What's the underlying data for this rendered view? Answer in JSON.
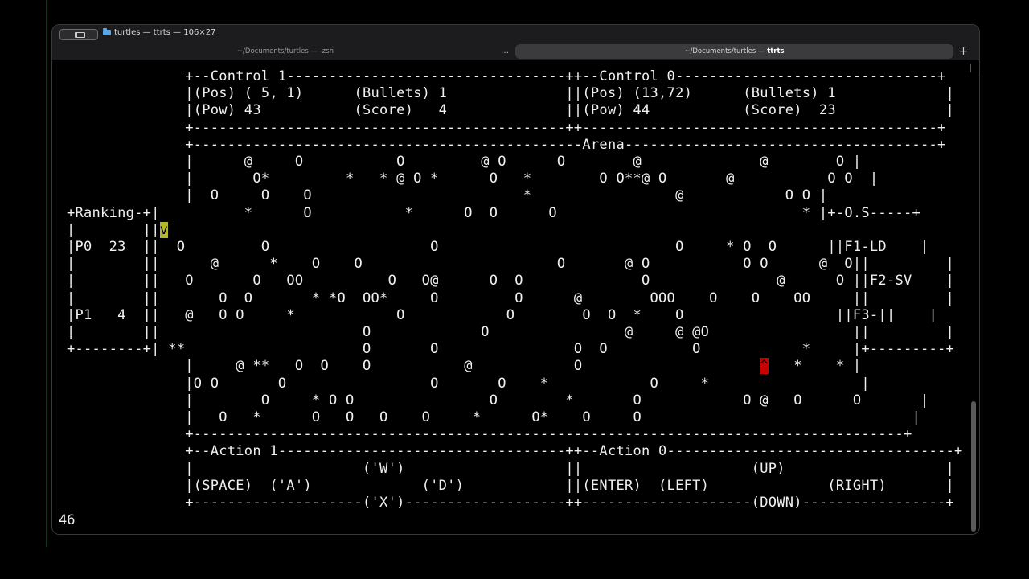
{
  "window": {
    "title": "turtles — ttrts — 106×27",
    "tabs": [
      {
        "label": "~/Documents/turtles — -zsh"
      },
      {
        "label_prefix": "~/Documents/turtles — ",
        "label_bold": "ttrts"
      }
    ],
    "overflow_tabs": "…",
    "new_tab": "+"
  },
  "terminal": {
    "status": "46",
    "colors": {
      "player_highlight": "#b5b82b",
      "enemy_highlight": "#c80000"
    },
    "player_glyph": "v",
    "enemy_glyph": "^",
    "lines": [
      "              +--Control 1---------------------------------++--Control 0-------------------------------+",
      "              |(Pos) ( 5, 1)      (Bullets) 1              ||(Pos) (13,72)      (Bullets) 1             |",
      "              |(Pow) 43           (Score)   4              ||(Pow) 44           (Score)  23             |",
      "              +--------------------------------------------++------------------------------------------+",
      "              +----------------------------------------------Arena-------------------------------------+",
      "              |      @     O           O         @ O      O        @              @        O |",
      "              |       O*         *   * @ O *      O   *        O O**@ O       @           O O  |",
      "              |  O     O    O                         *                 @            O O |",
      "+Ranking-+|          *      O           *      O  O      O                             * |+-O.S-----+",
      "|        ||",
      "|P0  23  ||  O         O                   O                            O     * O  O      ||F1-LD    |",
      "|        ||      @      *    O    O                       O       @ O           O O      @  O||         |",
      "|        ||   O       O   OO          O   O@      O  O              O               @      O ||F2-SV    |",
      "|        ||       O  O       * *O  OO*     O         O      @        OOO    O    O    OO     ||         |",
      "|P1   4  ||   @   O O     *            O            O        O  O  *    O                  ||F3-||    |",
      "|        ||                        O             O                @     @ @O                 ||         |",
      "+--------+| **                     O       O                O  O          O            *     |+---------+",
      "              |     @ **   O  O    O           @            O                         *    * |",
      "              |O O       O                 O       O    *            O     *                  |",
      "              |        O     * O O                O        *       O            O @   O      O       |",
      "              |   O   *      O   O   O    O     *      O*    O     O                                |",
      "              +------------------------------------------------------------------------------------+",
      "              +--Action 1----------------------------------++--Action 0----------------------------------+",
      "              |                    ('W')                   ||                    (UP)                   |",
      "              |(SPACE)  ('A')             ('D')            ||(ENTER)  (LEFT)              (RIGHT)       |",
      "              +--------------------('X')-------------------++--------------------(DOWN)-----------------+"
    ]
  }
}
